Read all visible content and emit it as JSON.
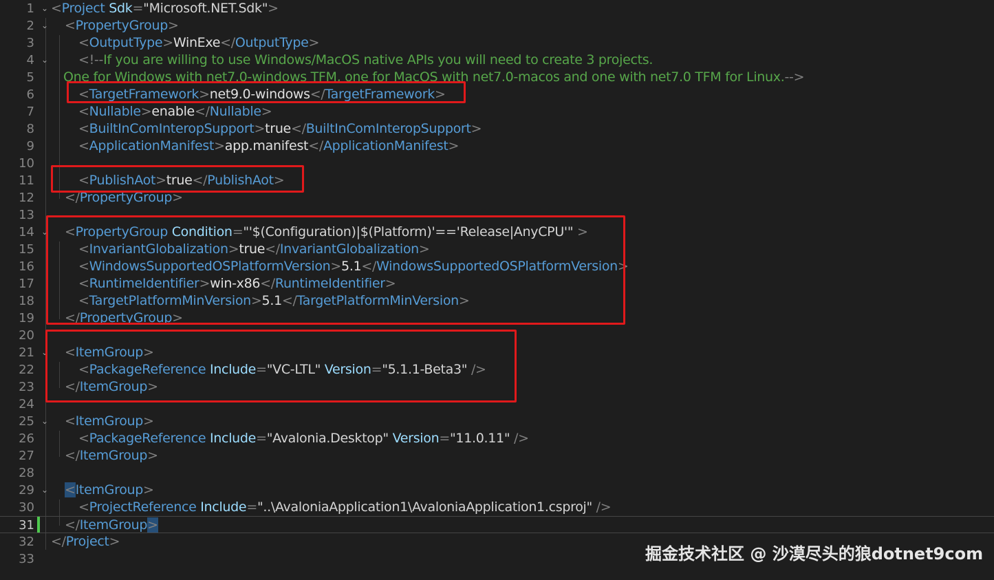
{
  "editor": {
    "colors": {
      "background": "#1e1e1e",
      "tag": "#569cd6",
      "attribute": "#9cdcfe",
      "comment": "#57a64a",
      "highlight_box": "#e0191b"
    },
    "current_line": 31,
    "lines": [
      {
        "n": "1",
        "fold": "v",
        "ind": 0,
        "parts": [
          [
            "br",
            "<"
          ],
          [
            "tag",
            "Project"
          ],
          [
            "attr",
            " Sdk"
          ],
          [
            "br",
            "="
          ],
          [
            "str",
            "\"Microsoft.NET.Sdk\""
          ],
          [
            "br",
            ">"
          ]
        ]
      },
      {
        "n": "2",
        "fold": "v",
        "ind": 1,
        "parts": [
          [
            "br",
            "<"
          ],
          [
            "tag",
            "PropertyGroup"
          ],
          [
            "br",
            ">"
          ]
        ]
      },
      {
        "n": "3",
        "fold": "",
        "ind": 2,
        "parts": [
          [
            "br",
            "<"
          ],
          [
            "tag",
            "OutputType"
          ],
          [
            "br",
            ">"
          ],
          [
            "txt",
            "WinExe"
          ],
          [
            "br",
            "</"
          ],
          [
            "tag",
            "OutputType"
          ],
          [
            "br",
            ">"
          ]
        ]
      },
      {
        "n": "4",
        "fold": "v",
        "ind": 2,
        "parts": [
          [
            "br",
            "<!--"
          ],
          [
            "cmt",
            "If you are willing to use Windows/MacOS native APIs you will need to create 3 projects."
          ]
        ]
      },
      {
        "n": "5",
        "fold": "",
        "ind": 0.9,
        "parts": [
          [
            "cmt",
            "One for Windows with net7.0-windows TFM, one for MacOS with net7.0-macos and one with net7.0 TFM for Linux."
          ],
          [
            "br",
            "-->"
          ]
        ]
      },
      {
        "n": "6",
        "fold": "",
        "ind": 2,
        "parts": [
          [
            "br",
            "<"
          ],
          [
            "tag",
            "TargetFramework"
          ],
          [
            "br",
            ">"
          ],
          [
            "txt",
            "net9.0-windows"
          ],
          [
            "br",
            "</"
          ],
          [
            "tag",
            "TargetFramework"
          ],
          [
            "br",
            ">"
          ]
        ]
      },
      {
        "n": "7",
        "fold": "",
        "ind": 2,
        "parts": [
          [
            "br",
            "<"
          ],
          [
            "tag",
            "Nullable"
          ],
          [
            "br",
            ">"
          ],
          [
            "txt",
            "enable"
          ],
          [
            "br",
            "</"
          ],
          [
            "tag",
            "Nullable"
          ],
          [
            "br",
            ">"
          ]
        ]
      },
      {
        "n": "8",
        "fold": "",
        "ind": 2,
        "parts": [
          [
            "br",
            "<"
          ],
          [
            "tag",
            "BuiltInComInteropSupport"
          ],
          [
            "br",
            ">"
          ],
          [
            "txt",
            "true"
          ],
          [
            "br",
            "</"
          ],
          [
            "tag",
            "BuiltInComInteropSupport"
          ],
          [
            "br",
            ">"
          ]
        ]
      },
      {
        "n": "9",
        "fold": "",
        "ind": 2,
        "parts": [
          [
            "br",
            "<"
          ],
          [
            "tag",
            "ApplicationManifest"
          ],
          [
            "br",
            ">"
          ],
          [
            "txt",
            "app.manifest"
          ],
          [
            "br",
            "</"
          ],
          [
            "tag",
            "ApplicationManifest"
          ],
          [
            "br",
            ">"
          ]
        ]
      },
      {
        "n": "10",
        "fold": "",
        "ind": 0,
        "parts": []
      },
      {
        "n": "11",
        "fold": "",
        "ind": 2,
        "parts": [
          [
            "br",
            "<"
          ],
          [
            "tag",
            "PublishAot"
          ],
          [
            "br",
            ">"
          ],
          [
            "txt",
            "true"
          ],
          [
            "br",
            "</"
          ],
          [
            "tag",
            "PublishAot"
          ],
          [
            "br",
            ">"
          ]
        ]
      },
      {
        "n": "12",
        "fold": "",
        "ind": 1,
        "parts": [
          [
            "br",
            "</"
          ],
          [
            "tag",
            "PropertyGroup"
          ],
          [
            "br",
            ">"
          ]
        ]
      },
      {
        "n": "13",
        "fold": "",
        "ind": 0,
        "parts": []
      },
      {
        "n": "14",
        "fold": "v",
        "ind": 1,
        "parts": [
          [
            "br",
            "<"
          ],
          [
            "tag",
            "PropertyGroup"
          ],
          [
            "attr",
            " Condition"
          ],
          [
            "br",
            "="
          ],
          [
            "str",
            "\"'$(Configuration)|$(Platform)'=='Release|AnyCPU'\""
          ],
          [
            "br",
            " >"
          ]
        ]
      },
      {
        "n": "15",
        "fold": "",
        "ind": 2,
        "parts": [
          [
            "br",
            "<"
          ],
          [
            "tag",
            "InvariantGlobalization"
          ],
          [
            "br",
            ">"
          ],
          [
            "txt",
            "true"
          ],
          [
            "br",
            "</"
          ],
          [
            "tag",
            "InvariantGlobalization"
          ],
          [
            "br",
            ">"
          ]
        ]
      },
      {
        "n": "16",
        "fold": "",
        "ind": 2,
        "parts": [
          [
            "br",
            "<"
          ],
          [
            "tag",
            "WindowsSupportedOSPlatformVersion"
          ],
          [
            "br",
            ">"
          ],
          [
            "txt",
            "5.1"
          ],
          [
            "br",
            "</"
          ],
          [
            "tag",
            "WindowsSupportedOSPlatformVersion"
          ],
          [
            "br",
            ">"
          ]
        ]
      },
      {
        "n": "17",
        "fold": "",
        "ind": 2,
        "parts": [
          [
            "br",
            "<"
          ],
          [
            "tag",
            "RuntimeIdentifier"
          ],
          [
            "br",
            ">"
          ],
          [
            "txt",
            "win-x86"
          ],
          [
            "br",
            "</"
          ],
          [
            "tag",
            "RuntimeIdentifier"
          ],
          [
            "br",
            ">"
          ]
        ]
      },
      {
        "n": "18",
        "fold": "",
        "ind": 2,
        "parts": [
          [
            "br",
            "<"
          ],
          [
            "tag",
            "TargetPlatformMinVersion"
          ],
          [
            "br",
            ">"
          ],
          [
            "txt",
            "5.1"
          ],
          [
            "br",
            "</"
          ],
          [
            "tag",
            "TargetPlatformMinVersion"
          ],
          [
            "br",
            ">"
          ]
        ]
      },
      {
        "n": "19",
        "fold": "",
        "ind": 1,
        "parts": [
          [
            "br",
            "</"
          ],
          [
            "tag",
            "PropertyGroup"
          ],
          [
            "br",
            ">"
          ]
        ]
      },
      {
        "n": "20",
        "fold": "",
        "ind": 0,
        "parts": []
      },
      {
        "n": "21",
        "fold": "v",
        "ind": 1,
        "parts": [
          [
            "br",
            "<"
          ],
          [
            "tag",
            "ItemGroup"
          ],
          [
            "br",
            ">"
          ]
        ]
      },
      {
        "n": "22",
        "fold": "",
        "ind": 2,
        "parts": [
          [
            "br",
            "<"
          ],
          [
            "tag",
            "PackageReference"
          ],
          [
            "attr",
            " Include"
          ],
          [
            "br",
            "="
          ],
          [
            "str",
            "\"VC-LTL\""
          ],
          [
            "attr",
            " Version"
          ],
          [
            "br",
            "="
          ],
          [
            "str",
            "\"5.1.1-Beta3\""
          ],
          [
            "br",
            " />"
          ]
        ]
      },
      {
        "n": "23",
        "fold": "",
        "ind": 1,
        "parts": [
          [
            "br",
            "</"
          ],
          [
            "tag",
            "ItemGroup"
          ],
          [
            "br",
            ">"
          ]
        ]
      },
      {
        "n": "24",
        "fold": "",
        "ind": 0,
        "parts": []
      },
      {
        "n": "25",
        "fold": "v",
        "ind": 1,
        "parts": [
          [
            "br",
            "<"
          ],
          [
            "tag",
            "ItemGroup"
          ],
          [
            "br",
            ">"
          ]
        ]
      },
      {
        "n": "26",
        "fold": "",
        "ind": 2,
        "parts": [
          [
            "br",
            "<"
          ],
          [
            "tag",
            "PackageReference"
          ],
          [
            "attr",
            " Include"
          ],
          [
            "br",
            "="
          ],
          [
            "str",
            "\"Avalonia.Desktop\""
          ],
          [
            "attr",
            " Version"
          ],
          [
            "br",
            "="
          ],
          [
            "str",
            "\"11.0.11\""
          ],
          [
            "br",
            " />"
          ]
        ]
      },
      {
        "n": "27",
        "fold": "",
        "ind": 1,
        "parts": [
          [
            "br",
            "</"
          ],
          [
            "tag",
            "ItemGroup"
          ],
          [
            "br",
            ">"
          ]
        ]
      },
      {
        "n": "28",
        "fold": "",
        "ind": 0,
        "parts": []
      },
      {
        "n": "29",
        "fold": "v",
        "ind": 1,
        "parts": [
          [
            "brsel",
            "<"
          ],
          [
            "tag",
            "ItemGroup"
          ],
          [
            "br",
            ">"
          ]
        ]
      },
      {
        "n": "30",
        "fold": "",
        "ind": 2,
        "parts": [
          [
            "br",
            "<"
          ],
          [
            "tag",
            "ProjectReference"
          ],
          [
            "attr",
            " Include"
          ],
          [
            "br",
            "="
          ],
          [
            "str",
            "\"..\\AvaloniaApplication1\\AvaloniaApplication1.csproj\""
          ],
          [
            "br",
            " />"
          ]
        ]
      },
      {
        "n": "31",
        "fold": "",
        "ind": 1,
        "parts": [
          [
            "br",
            "</"
          ],
          [
            "tag",
            "ItemGroup"
          ],
          [
            "brsel",
            ">"
          ]
        ]
      },
      {
        "n": "32",
        "fold": "",
        "ind": 0,
        "parts": [
          [
            "br",
            "</"
          ],
          [
            "tag",
            "Project"
          ],
          [
            "br",
            ">"
          ]
        ]
      },
      {
        "n": "33",
        "fold": "",
        "ind": 0,
        "parts": []
      }
    ]
  },
  "watermark": "掘金技术社区 @ 沙漠尽头的狼dotnet9com"
}
